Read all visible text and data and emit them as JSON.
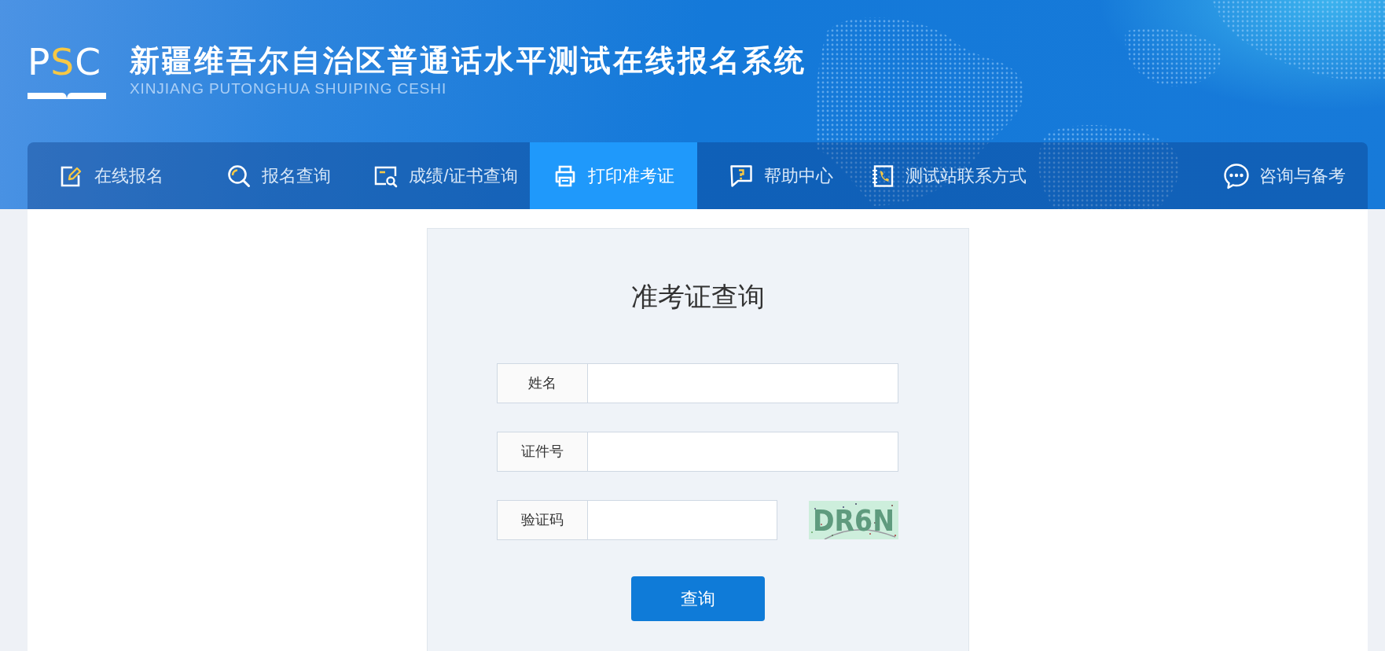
{
  "header": {
    "logo": {
      "letters": [
        {
          "text": "P",
          "accent": false
        },
        {
          "text": "S",
          "accent": true
        },
        {
          "text": "C",
          "accent": false
        }
      ]
    },
    "title": "新疆维吾尔自治区普通话水平测试在线报名系统",
    "subtitle": "XINJIANG PUTONGHUA SHUIPING CESHI"
  },
  "nav": {
    "items": [
      {
        "label": "在线报名",
        "selected": false
      },
      {
        "label": "报名查询",
        "selected": false
      },
      {
        "label": "成绩/证书查询",
        "selected": false
      },
      {
        "label": "打印准考证",
        "selected": true
      },
      {
        "label": "帮助中心",
        "selected": false
      },
      {
        "label": "测试站联系方式",
        "selected": false
      }
    ],
    "right_link": {
      "label": "咨询与备考"
    }
  },
  "form": {
    "title": "准考证查询",
    "fields": [
      {
        "kind": "text",
        "label": "姓名"
      },
      {
        "kind": "text",
        "label": "证件号"
      },
      {
        "kind": "captcha",
        "label": "验证码",
        "captcha_text": "DR6N"
      }
    ],
    "submit": "查询"
  }
}
